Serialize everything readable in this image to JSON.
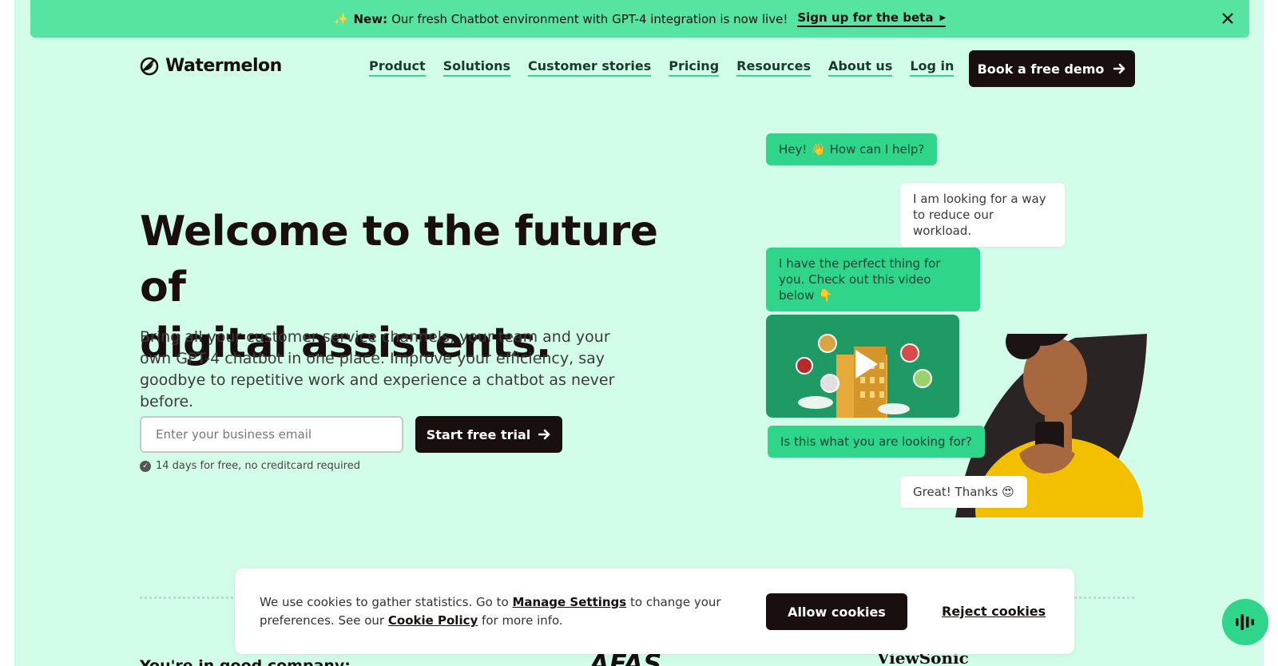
{
  "announcement": {
    "sparkle": "✨",
    "bold_label": "New:",
    "text": "Our fresh Chatbot environment with GPT-4 integration is now live!",
    "cta": "Sign up for the beta",
    "cta_arrow": "▶"
  },
  "header": {
    "logo_text": "Watermelon",
    "nav": [
      "Product",
      "Solutions",
      "Customer stories",
      "Pricing",
      "Resources",
      "About us",
      "Log in"
    ],
    "demo_button": "Book a free demo"
  },
  "hero": {
    "title_line1": "Welcome to the future of",
    "title_line2": "digital assistents",
    "title_dot": ".",
    "subtitle": "Bring all your customer service channels, your team and your own GPT-4 chatbot in one place. Improve your efficiency, say goodbye to repetitive work and experience a chatbot as never before.",
    "email_placeholder": "Enter your business email",
    "trial_button": "Start free trial",
    "trial_note": "14 days for free, no creditcard required"
  },
  "chat": {
    "msg1": "Hey! 👋 How can I help?",
    "msg2": "I am looking for a way to reduce our workload.",
    "msg3": "I have the perfect thing for you. Check out this video below 👇",
    "msg4": "Is this what you are looking for?",
    "msg5": "Great! Thanks 😍"
  },
  "social_proof": {
    "heading": "You're in good company:",
    "logos": [
      "AFAS",
      "ViewSonic"
    ]
  },
  "cookie": {
    "text_before": "We use cookies to gather statistics. Go to",
    "manage_link": "Manage Settings",
    "text_middle": "to change your preferences. See our",
    "policy_link": "Cookie Policy",
    "text_after": "for more info.",
    "allow_button": "Allow cookies",
    "reject_button": "Reject cookies"
  },
  "colors": {
    "page_bg": "#d2fde9",
    "announce_bg": "#57e3a2",
    "accent_green": "#2fd58b",
    "dark": "#1a0f0f"
  }
}
